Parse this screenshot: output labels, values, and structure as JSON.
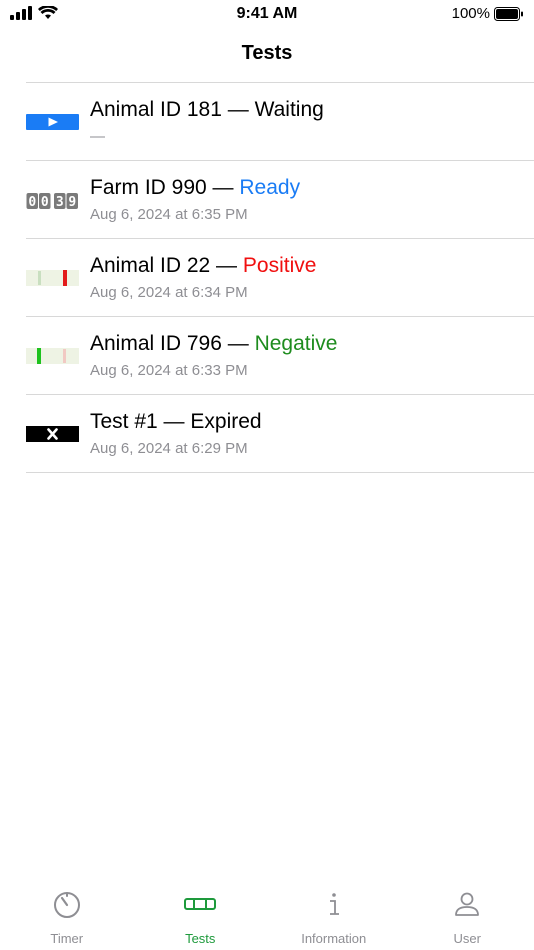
{
  "status_bar": {
    "time": "9:41 AM",
    "battery": "100%"
  },
  "nav": {
    "title": "Tests"
  },
  "tests": [
    {
      "icon": "play-icon",
      "title": "Animal ID 181 — ",
      "status": "Waiting",
      "status_color": "#000000",
      "subtitle": "—"
    },
    {
      "icon": "countdown-icon",
      "countdown": [
        "0",
        "0",
        "3",
        "9"
      ],
      "title": "Farm ID 990 — ",
      "status": "Ready",
      "status_color": "#1a7cf5",
      "subtitle": "Aug 6, 2024 at 6:35 PM"
    },
    {
      "icon": "positive-strip-icon",
      "title": "Animal ID 22 — ",
      "status": "Positive",
      "status_color": "#f00f0f",
      "subtitle": "Aug 6, 2024 at 6:34 PM"
    },
    {
      "icon": "negative-strip-icon",
      "title": "Animal ID 796 — ",
      "status": "Negative",
      "status_color": "#1e8c1e",
      "subtitle": "Aug 6, 2024 at 6:33 PM"
    },
    {
      "icon": "expired-icon",
      "title": "Test #1 — ",
      "status": "Expired",
      "status_color": "#000000",
      "subtitle": "Aug 6, 2024 at 6:29 PM"
    }
  ],
  "tabs": [
    {
      "label": "Timer",
      "icon": "timer-icon",
      "active": false
    },
    {
      "label": "Tests",
      "icon": "test-strip-icon",
      "active": true
    },
    {
      "label": "Information",
      "icon": "info-icon",
      "active": false
    },
    {
      "label": "User",
      "icon": "person-icon",
      "active": false
    }
  ],
  "colors": {
    "accent_green": "#1e9a3c",
    "blue": "#1a7cf5",
    "red": "#f00f0f",
    "green": "#1e8c1e",
    "gray": "#8e8e93"
  }
}
